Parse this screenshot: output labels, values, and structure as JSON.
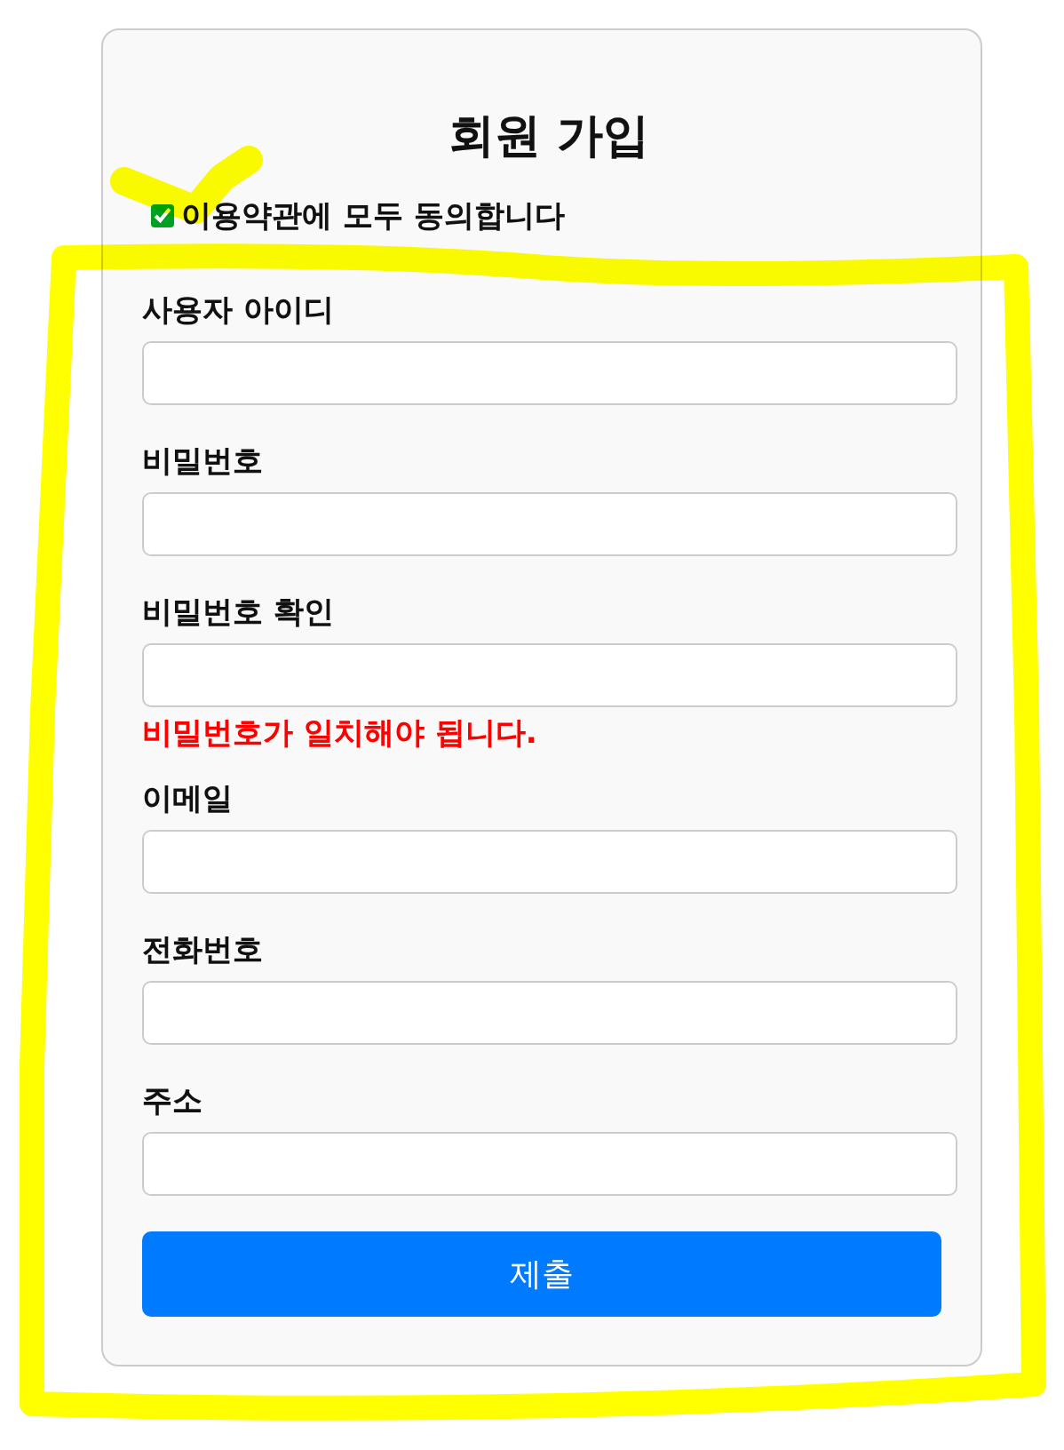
{
  "title": "회원 가입",
  "terms": {
    "label": "이용약관에 모두 동의합니다",
    "checked": true
  },
  "fields": [
    {
      "label": "사용자 아이디"
    },
    {
      "label": "비밀번호"
    },
    {
      "label": "비밀번호 확인",
      "error": "비밀번호가 일치해야 됩니다."
    },
    {
      "label": "이메일"
    },
    {
      "label": "전화번호"
    },
    {
      "label": "주소"
    }
  ],
  "submit": "제출"
}
